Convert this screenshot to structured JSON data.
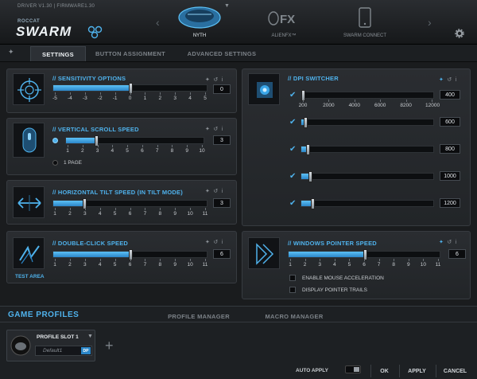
{
  "header": {
    "version": "DRIVER V1.30 | FIRMWARE1.30",
    "brand_small": "ROCCAT",
    "brand": "SWARM",
    "devices": [
      {
        "label": "NYTH",
        "icon": "mouse-icon"
      },
      {
        "label": "ALIENFX™",
        "icon": "alienfx-icon"
      },
      {
        "label": "SWARM CONNECT",
        "icon": "phone-icon"
      }
    ],
    "settings_icon": "gear-icon"
  },
  "tabs": [
    "SETTINGS",
    "BUTTON ASSIGNMENT",
    "ADVANCED SETTINGS"
  ],
  "sensitivity": {
    "title": "// SENSITIVITY OPTIONS",
    "ticks": [
      "-5",
      "-4",
      "-3",
      "-2",
      "-1",
      "0",
      "1",
      "2",
      "3",
      "4",
      "5"
    ],
    "value": "0"
  },
  "vscroll": {
    "title": "// VERTICAL SCROLL SPEED",
    "ticks": [
      "1",
      "2",
      "3",
      "4",
      "5",
      "6",
      "7",
      "8",
      "9",
      "10"
    ],
    "value": "3",
    "option": "1 PAGE"
  },
  "htilt": {
    "title": "// HORIZONTAL TILT SPEED (IN TILT MODE)",
    "ticks": [
      "1",
      "2",
      "3",
      "4",
      "5",
      "6",
      "7",
      "8",
      "9",
      "10",
      "11"
    ],
    "value": "3"
  },
  "dblclick": {
    "title": "// DOUBLE-CLICK SPEED",
    "ticks": [
      "1",
      "2",
      "3",
      "4",
      "5",
      "6",
      "7",
      "8",
      "9",
      "10",
      "11"
    ],
    "value": "6",
    "link": "TEST AREA"
  },
  "dpi": {
    "title": "// DPI SWITCHER",
    "ticks": [
      "200",
      "2000",
      "4000",
      "6000",
      "8200",
      "12000"
    ],
    "rows": [
      {
        "value": "400",
        "level": 0.017
      },
      {
        "value": "600",
        "level": 0.034
      },
      {
        "value": "800",
        "level": 0.05
      },
      {
        "value": "1000",
        "level": 0.067
      },
      {
        "value": "1200",
        "level": 0.084
      }
    ]
  },
  "pointer": {
    "title": "// WINDOWS POINTER SPEED",
    "ticks": [
      "1",
      "2",
      "3",
      "4",
      "5",
      "6",
      "7",
      "8",
      "9",
      "10",
      "11"
    ],
    "value": "6",
    "options": [
      "ENABLE MOUSE ACCELERATION",
      "DISPLAY POINTER TRAILS"
    ]
  },
  "footer": {
    "title": "GAME PROFILES",
    "tabs": [
      "PROFILE MANAGER",
      "MACRO MANAGER"
    ],
    "slot": "PROFILE SLOT 1",
    "profile_name": "Default1",
    "badge": "DP",
    "auto_apply": "AUTO APPLY",
    "buttons": [
      "OK",
      "APPLY",
      "CANCEL"
    ]
  },
  "colors": {
    "accent": "#4fb2ec",
    "background": "#1a1c1e"
  }
}
